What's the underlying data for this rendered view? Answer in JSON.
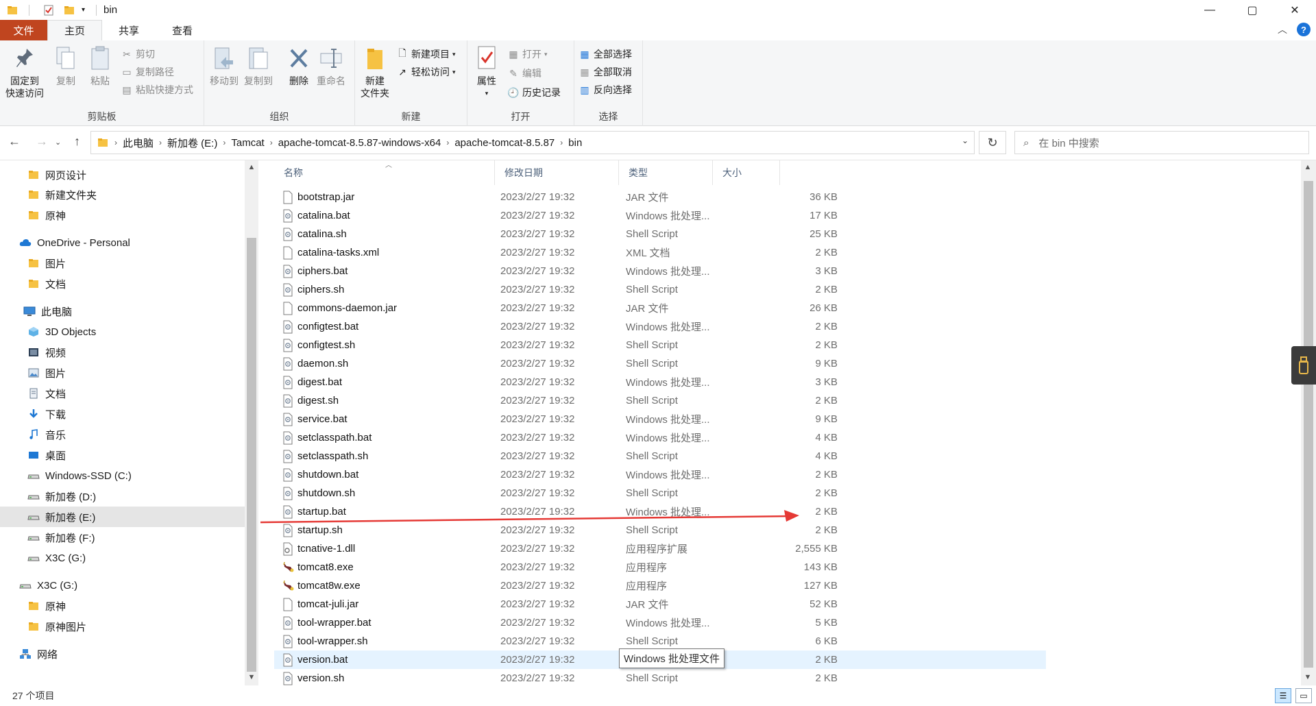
{
  "window": {
    "title": "bin",
    "controls": {
      "minimize": "—",
      "maximize": "▢",
      "close": "✕"
    }
  },
  "ribbon_tabs": {
    "file": "文件",
    "home": "主页",
    "share": "共享",
    "view": "查看"
  },
  "ribbon": {
    "clipboard": {
      "label": "剪贴板",
      "pin": "固定到\n快速访问",
      "pin_l1": "固定到",
      "pin_l2": "快速访问",
      "copy": "复制",
      "paste": "粘贴",
      "cut": "剪切",
      "copy_path": "复制路径",
      "paste_shortcut": "粘贴快捷方式"
    },
    "organize": {
      "label": "组织",
      "move_to": "移动到",
      "copy_to": "复制到",
      "delete": "删除",
      "rename": "重命名"
    },
    "new": {
      "label": "新建",
      "new_folder_l1": "新建",
      "new_folder_l2": "文件夹",
      "new_item": "新建项目",
      "easy_access": "轻松访问"
    },
    "open": {
      "label": "打开",
      "properties": "属性",
      "open": "打开",
      "edit": "编辑",
      "history": "历史记录"
    },
    "select": {
      "label": "选择",
      "select_all": "全部选择",
      "select_none": "全部取消",
      "invert": "反向选择"
    }
  },
  "address": {
    "crumbs": [
      "此电脑",
      "新加卷 (E:)",
      "Tamcat",
      "apache-tomcat-8.5.87-windows-x64",
      "apache-tomcat-8.5.87",
      "bin"
    ],
    "search_placeholder": "在 bin 中搜索"
  },
  "nav_pane": [
    {
      "label": "网页设计",
      "icon": "folder-icon"
    },
    {
      "label": "新建文件夹",
      "icon": "folder-icon"
    },
    {
      "label": "原神",
      "icon": "folder-icon"
    },
    {
      "label": "OneDrive - Personal",
      "icon": "cloud-icon"
    },
    {
      "label": "图片",
      "icon": "folder-icon"
    },
    {
      "label": "文档",
      "icon": "folder-icon"
    },
    {
      "label": "此电脑",
      "icon": "computer-icon"
    },
    {
      "label": "3D Objects",
      "icon": "cube-icon"
    },
    {
      "label": "视频",
      "icon": "video-icon"
    },
    {
      "label": "图片",
      "icon": "pictures-icon"
    },
    {
      "label": "文档",
      "icon": "documents-icon"
    },
    {
      "label": "下载",
      "icon": "download-icon"
    },
    {
      "label": "音乐",
      "icon": "music-icon"
    },
    {
      "label": "桌面",
      "icon": "desktop-icon"
    },
    {
      "label": "Windows-SSD (C:)",
      "icon": "drive-icon"
    },
    {
      "label": "新加卷 (D:)",
      "icon": "drive-icon"
    },
    {
      "label": "新加卷 (E:)",
      "icon": "drive-icon"
    },
    {
      "label": "新加卷 (F:)",
      "icon": "drive-icon"
    },
    {
      "label": "X3C (G:)",
      "icon": "drive-icon"
    },
    {
      "label": "X3C (G:)",
      "icon": "drive-icon"
    },
    {
      "label": "原神",
      "icon": "folder-icon"
    },
    {
      "label": "原神图片",
      "icon": "folder-icon"
    },
    {
      "label": "网络",
      "icon": "network-icon"
    }
  ],
  "columns": {
    "name": "名称",
    "date": "修改日期",
    "type": "类型",
    "size": "大小"
  },
  "files": [
    {
      "name": "bootstrap.jar",
      "date": "2023/2/27 19:32",
      "type": "JAR 文件",
      "size": "36 KB",
      "icon": "file-icon"
    },
    {
      "name": "catalina.bat",
      "date": "2023/2/27 19:32",
      "type": "Windows 批处理...",
      "size": "17 KB",
      "icon": "script-icon"
    },
    {
      "name": "catalina.sh",
      "date": "2023/2/27 19:32",
      "type": "Shell Script",
      "size": "25 KB",
      "icon": "script-icon"
    },
    {
      "name": "catalina-tasks.xml",
      "date": "2023/2/27 19:32",
      "type": "XML 文档",
      "size": "2 KB",
      "icon": "file-icon"
    },
    {
      "name": "ciphers.bat",
      "date": "2023/2/27 19:32",
      "type": "Windows 批处理...",
      "size": "3 KB",
      "icon": "script-icon"
    },
    {
      "name": "ciphers.sh",
      "date": "2023/2/27 19:32",
      "type": "Shell Script",
      "size": "2 KB",
      "icon": "script-icon"
    },
    {
      "name": "commons-daemon.jar",
      "date": "2023/2/27 19:32",
      "type": "JAR 文件",
      "size": "26 KB",
      "icon": "file-icon"
    },
    {
      "name": "configtest.bat",
      "date": "2023/2/27 19:32",
      "type": "Windows 批处理...",
      "size": "2 KB",
      "icon": "script-icon"
    },
    {
      "name": "configtest.sh",
      "date": "2023/2/27 19:32",
      "type": "Shell Script",
      "size": "2 KB",
      "icon": "script-icon"
    },
    {
      "name": "daemon.sh",
      "date": "2023/2/27 19:32",
      "type": "Shell Script",
      "size": "9 KB",
      "icon": "script-icon"
    },
    {
      "name": "digest.bat",
      "date": "2023/2/27 19:32",
      "type": "Windows 批处理...",
      "size": "3 KB",
      "icon": "script-icon"
    },
    {
      "name": "digest.sh",
      "date": "2023/2/27 19:32",
      "type": "Shell Script",
      "size": "2 KB",
      "icon": "script-icon"
    },
    {
      "name": "service.bat",
      "date": "2023/2/27 19:32",
      "type": "Windows 批处理...",
      "size": "9 KB",
      "icon": "script-icon"
    },
    {
      "name": "setclasspath.bat",
      "date": "2023/2/27 19:32",
      "type": "Windows 批处理...",
      "size": "4 KB",
      "icon": "script-icon"
    },
    {
      "name": "setclasspath.sh",
      "date": "2023/2/27 19:32",
      "type": "Shell Script",
      "size": "4 KB",
      "icon": "script-icon"
    },
    {
      "name": "shutdown.bat",
      "date": "2023/2/27 19:32",
      "type": "Windows 批处理...",
      "size": "2 KB",
      "icon": "script-icon"
    },
    {
      "name": "shutdown.sh",
      "date": "2023/2/27 19:32",
      "type": "Shell Script",
      "size": "2 KB",
      "icon": "script-icon"
    },
    {
      "name": "startup.bat",
      "date": "2023/2/27 19:32",
      "type": "Windows 批处理...",
      "size": "2 KB",
      "icon": "script-icon"
    },
    {
      "name": "startup.sh",
      "date": "2023/2/27 19:32",
      "type": "Shell Script",
      "size": "2 KB",
      "icon": "script-icon"
    },
    {
      "name": "tcnative-1.dll",
      "date": "2023/2/27 19:32",
      "type": "应用程序扩展",
      "size": "2,555 KB",
      "icon": "dll-icon"
    },
    {
      "name": "tomcat8.exe",
      "date": "2023/2/27 19:32",
      "type": "应用程序",
      "size": "143 KB",
      "icon": "tomcat-icon"
    },
    {
      "name": "tomcat8w.exe",
      "date": "2023/2/27 19:32",
      "type": "应用程序",
      "size": "127 KB",
      "icon": "tomcat-icon"
    },
    {
      "name": "tomcat-juli.jar",
      "date": "2023/2/27 19:32",
      "type": "JAR 文件",
      "size": "52 KB",
      "icon": "file-icon"
    },
    {
      "name": "tool-wrapper.bat",
      "date": "2023/2/27 19:32",
      "type": "Windows 批处理...",
      "size": "5 KB",
      "icon": "script-icon"
    },
    {
      "name": "tool-wrapper.sh",
      "date": "2023/2/27 19:32",
      "type": "Shell Script",
      "size": "6 KB",
      "icon": "script-icon"
    },
    {
      "name": "version.bat",
      "date": "2023/2/27 19:32",
      "type": "",
      "size": "2 KB",
      "icon": "script-icon",
      "selected": true
    },
    {
      "name": "version.sh",
      "date": "2023/2/27 19:32",
      "type": "Shell Script",
      "size": "2 KB",
      "icon": "script-icon"
    }
  ],
  "tooltip": "Windows 批处理文件",
  "status": {
    "count": "27 个项目"
  },
  "colors": {
    "file_tab": "#c0451f",
    "accent_blue": "#1a73d9",
    "annotation_red": "#e53935",
    "selection": "#e5f3ff"
  }
}
